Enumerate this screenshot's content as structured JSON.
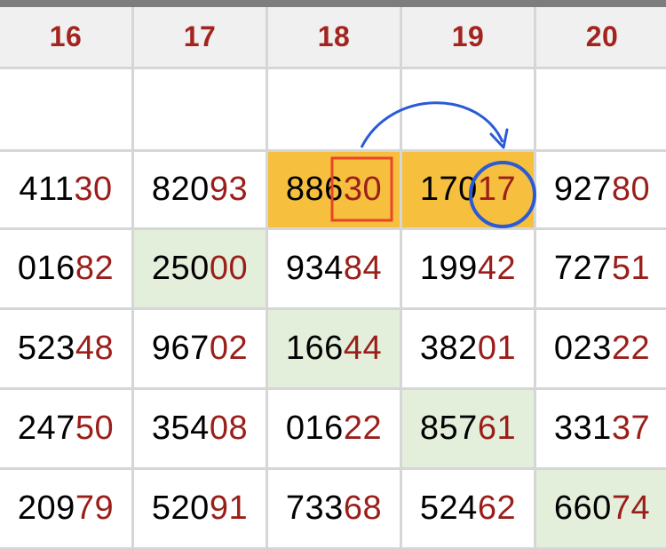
{
  "columns": [
    "16",
    "17",
    "18",
    "19",
    "20"
  ],
  "rows": [
    [
      {
        "head": "411",
        "tail": "30"
      },
      {
        "head": "820",
        "tail": "93"
      },
      {
        "head": "886",
        "tail": "30"
      },
      {
        "head": "170",
        "tail": "17"
      },
      {
        "head": "927",
        "tail": "80"
      }
    ],
    [
      {
        "head": "016",
        "tail": "82"
      },
      {
        "head": "250",
        "tail": "00"
      },
      {
        "head": "934",
        "tail": "84"
      },
      {
        "head": "199",
        "tail": "42"
      },
      {
        "head": "727",
        "tail": "51"
      }
    ],
    [
      {
        "head": "523",
        "tail": "48"
      },
      {
        "head": "967",
        "tail": "02"
      },
      {
        "head": "166",
        "tail": "44"
      },
      {
        "head": "382",
        "tail": "01"
      },
      {
        "head": "023",
        "tail": "22"
      }
    ],
    [
      {
        "head": "247",
        "tail": "50"
      },
      {
        "head": "354",
        "tail": "08"
      },
      {
        "head": "016",
        "tail": "22"
      },
      {
        "head": "857",
        "tail": "61"
      },
      {
        "head": "331",
        "tail": "37"
      }
    ],
    [
      {
        "head": "209",
        "tail": "79"
      },
      {
        "head": "520",
        "tail": "91"
      },
      {
        "head": "733",
        "tail": "68"
      },
      {
        "head": "524",
        "tail": "62"
      },
      {
        "head": "660",
        "tail": "74"
      }
    ]
  ],
  "colors": {
    "header_text": "#a2241f",
    "tail_digits": "#9a1e1a",
    "highlight_orange": "#f6bf3e",
    "highlight_green": "#e3efdb",
    "box_annotation": "#e8452a",
    "circle_arrow_annotation": "#2a5bd7"
  }
}
